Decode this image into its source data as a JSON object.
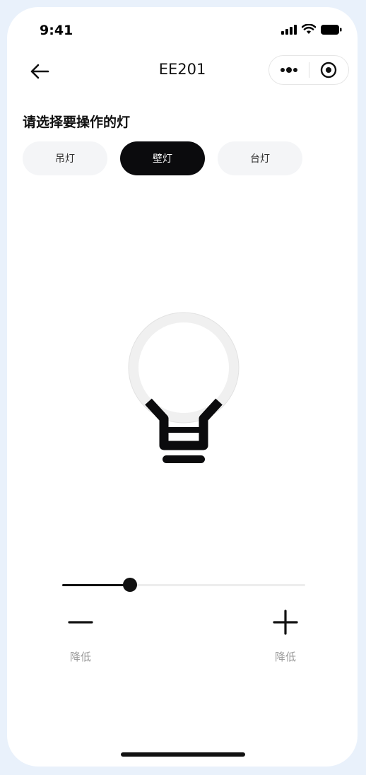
{
  "status_bar": {
    "time": "9:41",
    "icons": [
      "signal-icon",
      "wifi-icon",
      "battery-icon"
    ]
  },
  "nav": {
    "title": "EE201",
    "icons": [
      "back-arrow-icon",
      "more-dots-icon",
      "record-target-icon"
    ]
  },
  "lamp_select": {
    "title": "请选择要操作的灯",
    "options": [
      {
        "label": "吊灯",
        "selected": false
      },
      {
        "label": "壁灯",
        "selected": true
      },
      {
        "label": "台灯",
        "selected": false
      }
    ]
  },
  "brightness": {
    "value_fraction": 0.28,
    "decrease_label": "降低",
    "increase_label": "降低"
  },
  "colors": {
    "accent": "#0b0b0d",
    "tab_bg": "#f4f5f7",
    "track": "#ededed",
    "muted_text": "#9a9a9a",
    "frame": "#e9f1fb"
  }
}
